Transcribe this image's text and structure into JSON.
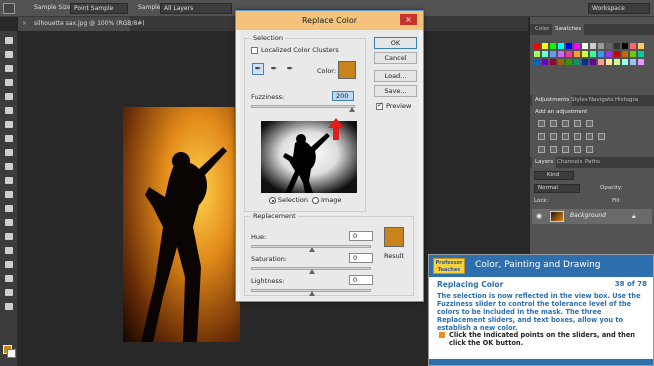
{
  "options_bar": {
    "sample_size_label": "Sample Size:",
    "sample_size_value": "Point Sample",
    "sample_label": "Sample:",
    "sample_value": "All Layers",
    "workspace": "Workspace"
  },
  "document": {
    "tab_label": "silhouette sax.jpg @ 100% (RGB/8#)",
    "close": "×"
  },
  "dialog": {
    "title": "Replace Color",
    "close": "×",
    "selection_label": "Selection",
    "localized_label": "Localized Color Clusters",
    "color_label": "Color:",
    "selection_color": "#c8831d",
    "fuzziness_label": "Fuzziness:",
    "fuzziness_value": "200",
    "fuzziness_fraction": 1.0,
    "radio_selection": "Selection",
    "radio_image": "Image",
    "replacement_label": "Replacement",
    "hue_label": "Hue:",
    "hue_value": "0",
    "saturation_label": "Saturation:",
    "saturation_value": "0",
    "lightness_label": "Lightness:",
    "lightness_value": "0",
    "result_label": "Result",
    "result_color": "#c8831d",
    "buttons": {
      "ok": "OK",
      "cancel": "Cancel",
      "load": "Load...",
      "save": "Save..."
    },
    "preview_label": "Preview",
    "eyedropper_icons": [
      "✒",
      "✒",
      "✒"
    ]
  },
  "panels": {
    "color_tab": "Color",
    "swatches_tab": "Swatches",
    "adjustments_tab": "Adjustments",
    "styles_tab": "Styles",
    "navigator_tab": "Navigato",
    "histogram_tab": "Histogra",
    "add_adjustment": "Add an adjustment",
    "layers_tab": "Layers",
    "channels_tab": "Channels",
    "paths_tab": "Paths",
    "kind_label": "Kind",
    "blend_mode": "Normal",
    "opacity_label": "Opacity:",
    "lock_label": "Lock:",
    "fill_label": "Fill:",
    "layer_name": "Background"
  },
  "swatch_colors": [
    "#ff0000",
    "#ffff00",
    "#00ff00",
    "#00ffff",
    "#0000ff",
    "#ff00ff",
    "#ffffff",
    "#cccccc",
    "#999999",
    "#666666",
    "#333333",
    "#000000",
    "#ff6666",
    "#ffcc66",
    "#99ff66",
    "#66ffcc",
    "#6699ff",
    "#cc66ff",
    "#ff3399",
    "#ff9933",
    "#ccff33",
    "#33ff99",
    "#3399ff",
    "#9933ff",
    "#cc0000",
    "#cc6600",
    "#66cc00",
    "#00cc99",
    "#0066cc",
    "#6600cc",
    "#990033",
    "#996600",
    "#339900",
    "#009966",
    "#003399",
    "#660099",
    "#ff9999",
    "#ffe599",
    "#c2ff99",
    "#99ffe5",
    "#99c2ff",
    "#e599ff"
  ],
  "tutorial": {
    "brand": "Professor Teaches",
    "title": "Color, Painting and Drawing",
    "subtitle": "Replacing Color",
    "count": "38 of 78",
    "paragraph": "The selection is now reflected in the view box. Use the Fuzziness slider to control the tolerance level of the colors to be included in the mask. The three Replacement sliders, and text boxes, allow you to establish a new color.",
    "instruction": "Click the indicated points on the sliders, and then click the OK button."
  }
}
